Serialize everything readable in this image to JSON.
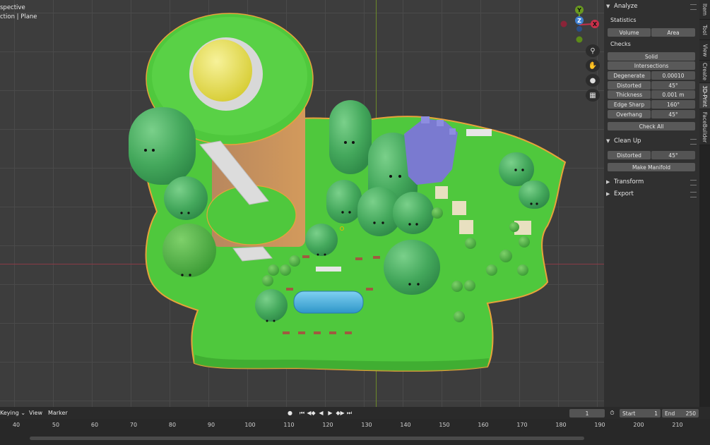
{
  "viewport": {
    "view_line1": "spective",
    "view_line2": "ction | Plane"
  },
  "gizmo": {
    "x": "X",
    "y": "Y",
    "z": "Z"
  },
  "nav_icons": [
    "zoom-icon",
    "hand-pan-icon",
    "camera-icon",
    "grid-icon"
  ],
  "npanel": {
    "analyze": {
      "title": "Analyze",
      "statistics_label": "Statistics",
      "volume_label": "Volume",
      "area_label": "Area",
      "checks_label": "Checks",
      "solid_label": "Solid",
      "intersections_label": "Intersections",
      "rows": [
        {
          "label": "Degenerate",
          "value": "0.00010"
        },
        {
          "label": "Distorted",
          "value": "45°"
        },
        {
          "label": "Thickness",
          "value": "0.001 m"
        },
        {
          "label": "Edge Sharp",
          "value": "160°"
        },
        {
          "label": "Overhang",
          "value": "45°"
        }
      ],
      "check_all_label": "Check All"
    },
    "cleanup": {
      "title": "Clean Up",
      "distorted_label": "Distorted",
      "distorted_value": "45°",
      "make_manifold_label": "Make Manifold"
    },
    "transform_title": "Transform",
    "export_title": "Export"
  },
  "tabs": [
    "Item",
    "Tool",
    "View",
    "Create",
    "3D-Print",
    "FaceBuilder"
  ],
  "active_tab": "3D-Print",
  "timeline": {
    "keying_label": "Keying",
    "view_label": "View",
    "marker_label": "Marker",
    "current_frame": "1",
    "start_label": "Start",
    "start_value": "1",
    "end_label": "End",
    "end_value": "250",
    "ruler": [
      "40",
      "50",
      "60",
      "70",
      "80",
      "90",
      "100",
      "110",
      "120",
      "130",
      "140",
      "150",
      "160",
      "170",
      "180",
      "190",
      "200",
      "210"
    ]
  },
  "colors": {
    "grass": "#4fc83d",
    "outline": "#e8a23a",
    "accent_x": "#c8304a",
    "accent_y": "#6a9a20",
    "accent_z": "#3f7fd0"
  }
}
